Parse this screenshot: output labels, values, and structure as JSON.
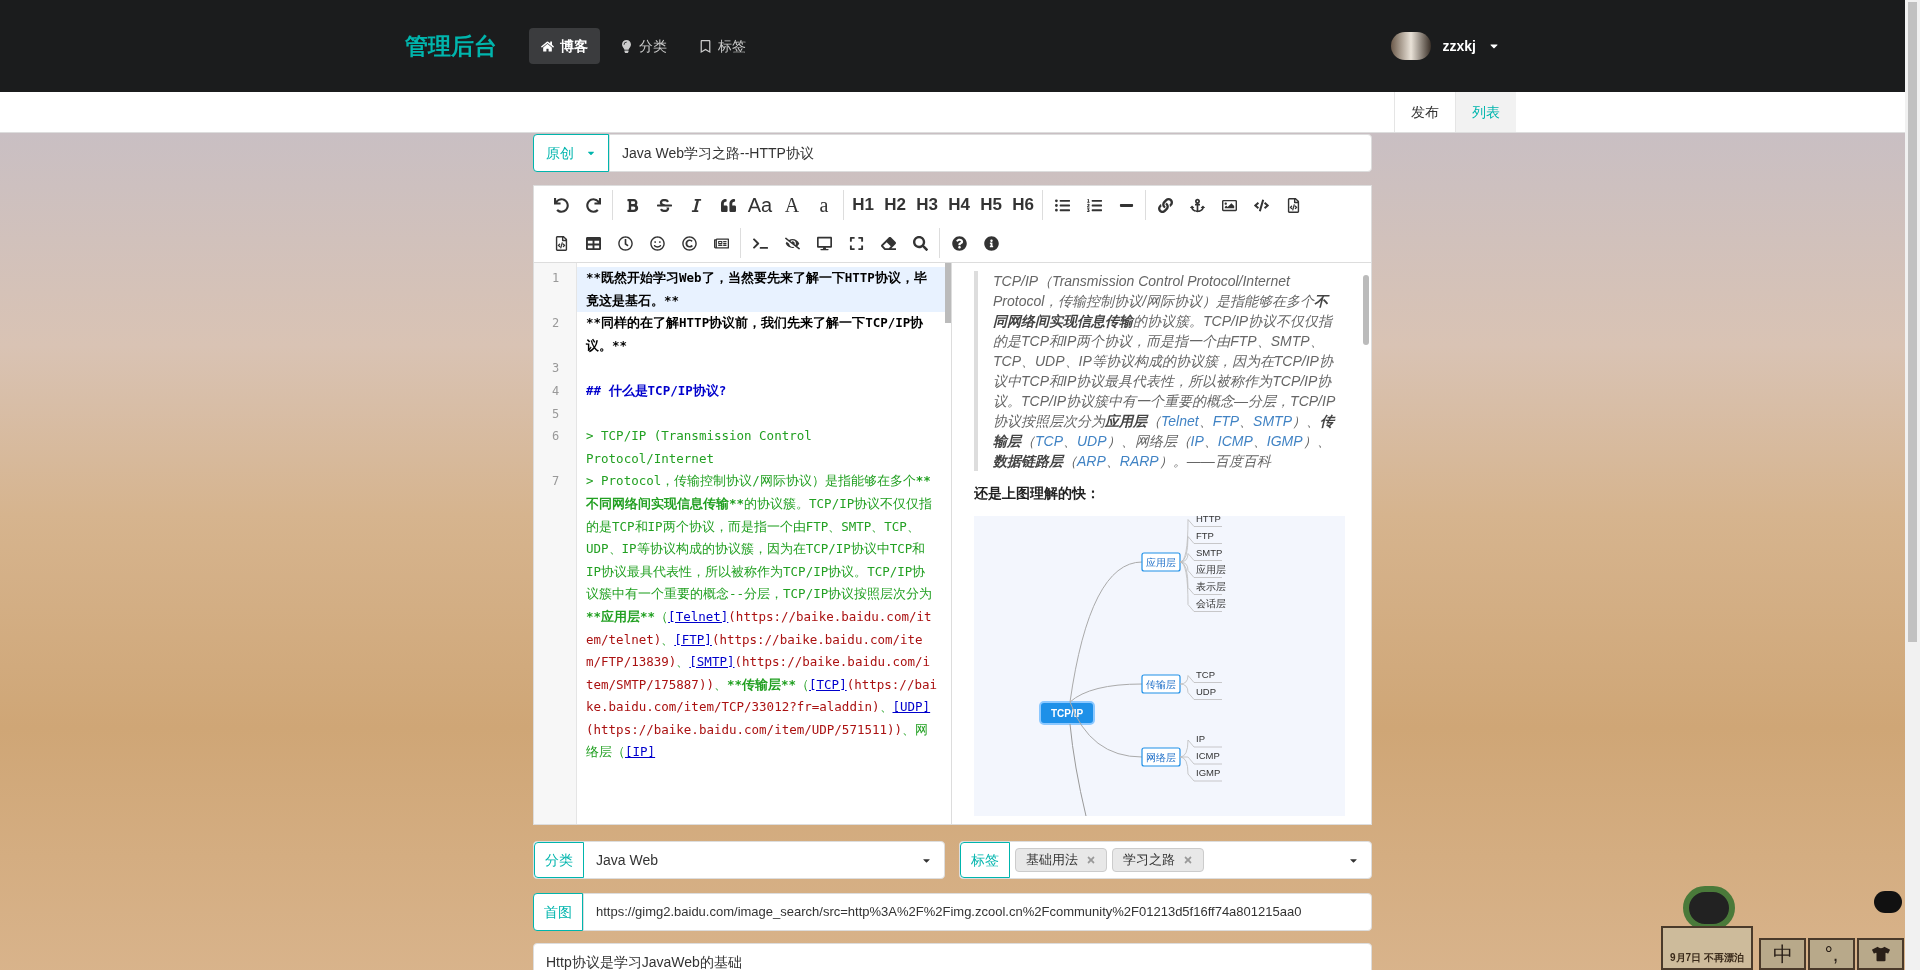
{
  "header": {
    "logo": "管理后台",
    "nav": [
      {
        "label": "博客",
        "selected": true
      },
      {
        "label": "分类",
        "selected": false
      },
      {
        "label": "标签",
        "selected": false
      }
    ],
    "user": {
      "name": "zzxkj"
    }
  },
  "subnav": [
    {
      "label": "发布",
      "selected": false
    },
    {
      "label": "列表",
      "selected": true
    }
  ],
  "title_row": {
    "type_select": "原创",
    "title": "Java Web学习之路--HTTP协议"
  },
  "toolbar": {
    "text_buttons": [
      "Aa",
      "A",
      "a",
      "H1",
      "H2",
      "H3",
      "H4",
      "H5",
      "H6"
    ]
  },
  "editor": {
    "lines": [
      {
        "number": "1",
        "active": true,
        "segments": [
          {
            "kind": "strong",
            "text": "**既然开始学习Web了，当然要先来了解一下HTTP协议，毕竟这是基石。**"
          }
        ]
      },
      {
        "number": "2",
        "active": false,
        "segments": [
          {
            "kind": "strong",
            "text": "**同样的在了解HTTP协议前，我们先来了解一下TCP/IP协议。**"
          }
        ]
      },
      {
        "number": "3",
        "active": false
      },
      {
        "number": "4",
        "active": false,
        "segments": [
          {
            "kind": "heading",
            "text": "## 什么是TCP/IP协议?"
          }
        ]
      },
      {
        "number": "5",
        "active": false
      },
      {
        "number": "6",
        "active": false,
        "segments": [
          {
            "kind": "quote",
            "text": "> TCP/IP (Transmission Control Protocol/Internet"
          }
        ]
      },
      {
        "number": "7",
        "active": false,
        "segments": [
          {
            "kind": "quote",
            "text": "> Protocol，传输控制协议/网际协议）是指能够在多个"
          },
          {
            "kind": "quote-strong",
            "text": "**不同网络间实现信息传输**"
          },
          {
            "kind": "quote",
            "text": "的协议簇。TCP/IP协议不仅仅指的是TCP和IP两个协议，而是指一个由FTP、SMTP、TCP、UDP、IP等协议构成的协议簇，因为在TCP/IP协议中TCP和IP协议最具代表性，所以被称作为TCP/IP协议。TCP/IP协议簇中有一个重要的概念--分层，TCP/IP协议按照层次分为"
          },
          {
            "kind": "quote-strong",
            "text": "**应用层**"
          },
          {
            "kind": "quote",
            "text": "（"
          },
          {
            "kind": "link",
            "text": "[Telnet]"
          },
          {
            "kind": "url",
            "text": "(https://baike.baidu.com/item/telnet)"
          },
          {
            "kind": "quote",
            "text": "、"
          },
          {
            "kind": "link",
            "text": "[FTP]"
          },
          {
            "kind": "url",
            "text": "(https://baike.baidu.com/item/FTP/13839)"
          },
          {
            "kind": "quote",
            "text": "、"
          },
          {
            "kind": "link",
            "text": "[SMTP]"
          },
          {
            "kind": "url",
            "text": "(https://baike.baidu.com/item/SMTP/175887))"
          },
          {
            "kind": "quote",
            "text": "、"
          },
          {
            "kind": "quote-strong",
            "text": "**传输层**"
          },
          {
            "kind": "quote",
            "text": "（"
          },
          {
            "kind": "link",
            "text": "[TCP]"
          },
          {
            "kind": "url",
            "text": "(https://baike.baidu.com/item/TCP/33012?fr=aladdin)"
          },
          {
            "kind": "quote",
            "text": "、"
          },
          {
            "kind": "link",
            "text": "[UDP]"
          },
          {
            "kind": "url",
            "text": "(https://baike.baidu.com/item/UDP/571511))"
          },
          {
            "kind": "quote",
            "text": "、网络层（"
          },
          {
            "kind": "link",
            "text": "[IP]"
          }
        ]
      }
    ]
  },
  "preview": {
    "quote": [
      {
        "kind": "text",
        "text": "TCP/IP（Transmission Control Protocol/Internet Protocol，传输控制协议/网际协议）是指能够在多个"
      },
      {
        "kind": "strong",
        "text": "不同网络间实现信息传输"
      },
      {
        "kind": "text",
        "text": "的协议簇。TCP/IP协议不仅仅指的是TCP和IP两个协议，而是指一个由FTP、SMTP、TCP、UDP、IP等协议构成的协议簇，因为在TCP/IP协议中TCP和IP协议最具代表性，所以被称作为TCP/IP协议。TCP/IP协议簇中有一个重要的概念—分层，TCP/IP协议按照层次分为"
      },
      {
        "kind": "strong",
        "text": "应用层"
      },
      {
        "kind": "text",
        "text": "（"
      },
      {
        "kind": "link",
        "text": "Telnet"
      },
      {
        "kind": "text",
        "text": "、"
      },
      {
        "kind": "link",
        "text": "FTP"
      },
      {
        "kind": "text",
        "text": "、"
      },
      {
        "kind": "link",
        "text": "SMTP"
      },
      {
        "kind": "text",
        "text": "）、"
      },
      {
        "kind": "strong",
        "text": "传输层"
      },
      {
        "kind": "text",
        "text": "（"
      },
      {
        "kind": "link",
        "text": "TCP"
      },
      {
        "kind": "text",
        "text": "、"
      },
      {
        "kind": "link",
        "text": "UDP"
      },
      {
        "kind": "text",
        "text": "）、网络层（"
      },
      {
        "kind": "link",
        "text": "IP"
      },
      {
        "kind": "text",
        "text": "、"
      },
      {
        "kind": "link",
        "text": "ICMP"
      },
      {
        "kind": "text",
        "text": "、"
      },
      {
        "kind": "link",
        "text": "IGMP"
      },
      {
        "kind": "text",
        "text": "）、"
      },
      {
        "kind": "strong",
        "text": "数据链路层"
      },
      {
        "kind": "text",
        "text": "（"
      },
      {
        "kind": "link",
        "text": "ARP"
      },
      {
        "kind": "text",
        "text": "、"
      },
      {
        "kind": "link",
        "text": "RARP"
      },
      {
        "kind": "text",
        "text": "）。——百度百科"
      }
    ],
    "paragraph": "还是上图理解的快：",
    "mind_map": {
      "root": "TCP/IP",
      "branches": [
        {
          "label": "应用层",
          "children": [
            "HTTP",
            "FTP",
            "SMTP",
            "应用层",
            "表示层",
            "会话层"
          ]
        },
        {
          "label": "传输层",
          "children": [
            "TCP",
            "UDP"
          ]
        },
        {
          "label": "网络层",
          "children": [
            "IP",
            "ICMP",
            "IGMP"
          ]
        }
      ]
    }
  },
  "category": {
    "label": "分类",
    "value": "Java Web"
  },
  "tags": {
    "label": "标签",
    "items": [
      "基础用法",
      "学习之路"
    ]
  },
  "cover": {
    "label": "首图",
    "value": "https://gimg2.baidu.com/image_search/src=http%3A%2F%2Fimg.zcool.cn%2Fcommunity%2F01213d5f16ff74a801215aa0"
  },
  "description": {
    "value": "Http协议是学习JavaWeb的基础"
  },
  "widget": {
    "sign": "9月7日 不再漂泊",
    "buttons": [
      "中",
      "°,"
    ]
  }
}
